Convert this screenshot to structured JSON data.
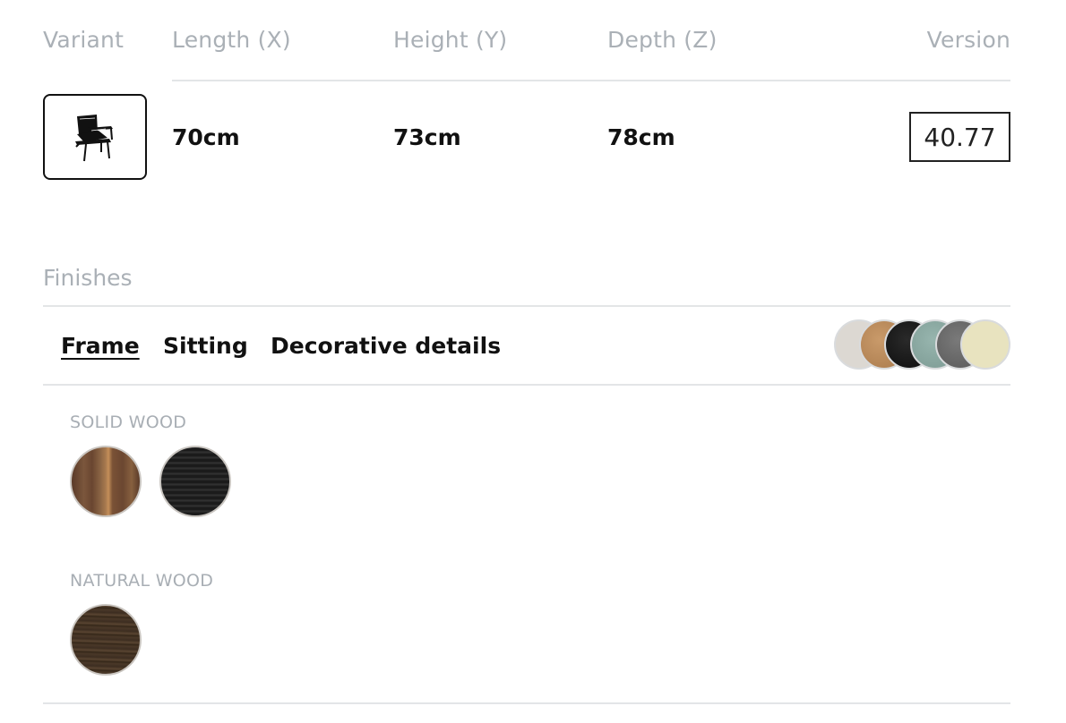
{
  "header": {
    "variant": "Variant",
    "length": "Length (X)",
    "height": "Height (Y)",
    "depth": "Depth (Z)",
    "version": "Version"
  },
  "row": {
    "length": "70cm",
    "height": "73cm",
    "depth": "78cm",
    "version": "40.77",
    "variant_icon": "armchair-icon"
  },
  "finishes": {
    "title": "Finishes",
    "tabs": [
      {
        "label": "Frame",
        "active": true
      },
      {
        "label": "Sitting",
        "active": false
      },
      {
        "label": "Decorative details",
        "active": false
      }
    ],
    "preview_colors": [
      "#dcd8d2",
      "#b88a5c",
      "#151515",
      "#86a6a0",
      "#6b6b6b",
      "#e8e3bf"
    ],
    "groups": [
      {
        "label": "SOLID WOOD",
        "swatches": [
          "walnut",
          "black-oak"
        ]
      },
      {
        "label": "NATURAL WOOD",
        "swatches": [
          "dark-wood"
        ]
      }
    ]
  }
}
